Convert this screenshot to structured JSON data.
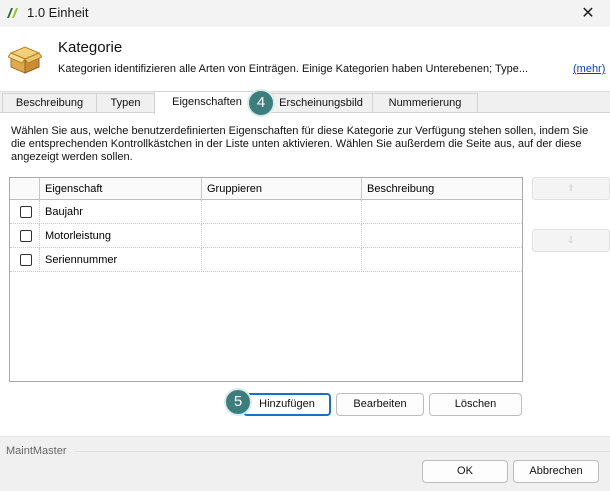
{
  "window": {
    "title": "1.0 Einheit",
    "app_icon": "maintmaster-logo-icon",
    "close_icon": "close-icon",
    "close_glyph": "✕"
  },
  "header": {
    "icon": "box-icon",
    "title": "Kategorie",
    "description": "Kategorien identifizieren alle Arten von Einträgen. Einige Kategorien haben Unterebenen; Type...",
    "more_link": "(mehr)"
  },
  "tabs": [
    {
      "label": "Beschreibung",
      "active": false
    },
    {
      "label": "Typen",
      "active": false
    },
    {
      "label": "Eigenschaften",
      "active": true
    },
    {
      "label": "Erscheinungsbild",
      "active": false
    },
    {
      "label": "Nummerierung",
      "active": false
    }
  ],
  "info_text": "Wählen Sie aus, welche benutzerdefinierten Eigenschaften für diese Kategorie zur Verfügung stehen sollen, indem Sie die entsprechenden Kontrollkästchen in der Liste unten aktivieren. Wählen Sie außerdem die Seite aus, auf der diese angezeigt werden sollen.",
  "grid": {
    "columns": [
      "Eigenschaft",
      "Gruppieren",
      "Beschreibung"
    ],
    "rows": [
      {
        "checked": false,
        "eigenschaft": "Baujahr",
        "gruppieren": "",
        "beschreibung": ""
      },
      {
        "checked": false,
        "eigenschaft": "Motorleistung",
        "gruppieren": "",
        "beschreibung": ""
      },
      {
        "checked": false,
        "eigenschaft": "Seriennummer",
        "gruppieren": "",
        "beschreibung": ""
      }
    ]
  },
  "side_buttons": {
    "up": {
      "icon": "arrow-up-icon",
      "glyph": "⇧",
      "enabled": false
    },
    "down": {
      "icon": "arrow-down-icon",
      "glyph": "⇩",
      "enabled": false
    }
  },
  "actions": {
    "add": "Hinzufügen",
    "edit": "Bearbeiten",
    "delete": "Löschen"
  },
  "markers": {
    "tab_marker": "4",
    "add_marker": "5"
  },
  "footer": {
    "brand": "MaintMaster",
    "ok": "OK",
    "cancel": "Abbrechen"
  },
  "colors": {
    "accent": "#1e6fbf",
    "marker": "#3d7d7d",
    "link": "#0a3fa8"
  }
}
